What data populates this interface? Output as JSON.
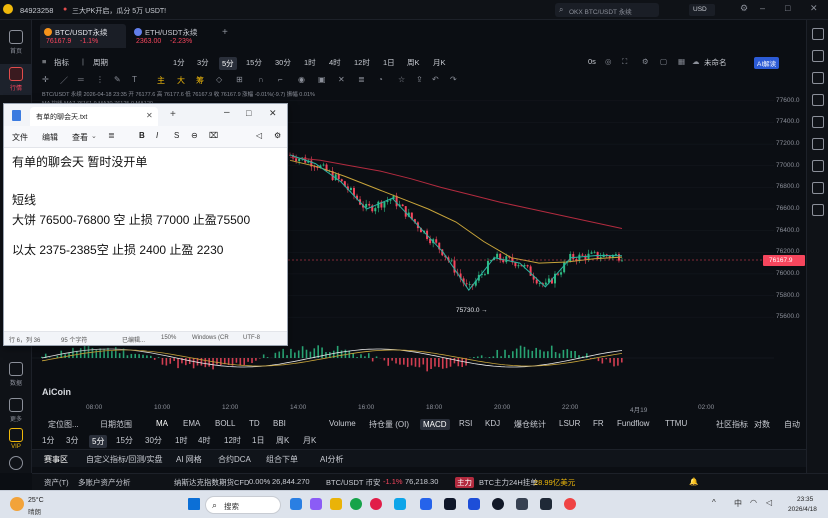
{
  "topbar": {
    "user_id": "84923258",
    "announcement": "三大PK开启，瓜分 5万 USDT!",
    "search_placeholder": "OKX BTC/USDT 永续",
    "currency": "USD"
  },
  "tabs": [
    {
      "name": "BTC/USDT永续",
      "price": "76167.9",
      "change": "-1.1%"
    },
    {
      "name": "ETH/USDT永续",
      "price": "2363.00",
      "change": "-2.23%"
    }
  ],
  "sidebar": {
    "items": [
      "首页",
      "行情",
      "数据",
      "更多",
      "VIP",
      "我的"
    ]
  },
  "timeframes": {
    "label_indicator": "指标",
    "label_period": "周期",
    "items": [
      "1分",
      "3分",
      "5分",
      "15分",
      "30分",
      "1时",
      "4时",
      "12时",
      "1日",
      "周K",
      "月K"
    ],
    "active": "5分",
    "time_label": "0s",
    "unnamed": "未命名",
    "ai_label": "AI解读"
  },
  "draw_tools": [
    "主",
    "大",
    "筹"
  ],
  "chart_info": {
    "line1": "BTC/USDT 永续  2026-04-18 23:35  开 76177.6  高 76177.6  低 76167.9  收 76167.9  涨幅 -0.01%(-9.7)  振幅 0.01%",
    "line2": "MA 均线  MA7 76161.9  MA30 76125.0  MA120 ..."
  },
  "chart_data": {
    "type": "line",
    "title": "BTC/USDT 永续",
    "xlabel": "",
    "ylabel": "",
    "y_ticks": [
      "77600.0",
      "77400.0",
      "77200.0",
      "77000.0",
      "76800.0",
      "76600.0",
      "76400.0",
      "76200.0",
      "76000.0",
      "75800.0",
      "75600.0"
    ],
    "x_ticks": [
      "08:00",
      "10:00",
      "12:00",
      "14:00",
      "16:00",
      "18:00",
      "20:00",
      "22:00",
      "4月19",
      "02:00"
    ],
    "last_price": "76167.9",
    "low_label": "75730.0",
    "ylim": [
      75500,
      77700
    ],
    "series": [
      {
        "name": "MA120",
        "color": "#b32b3f",
        "values": [
          77080,
          77050,
          77000,
          76950,
          76880,
          76800,
          76730,
          76660,
          76600,
          76540,
          76480,
          76420
        ]
      },
      {
        "name": "MA30",
        "color": "#c8a43a",
        "values": [
          77050,
          76990,
          76900,
          76800,
          76700,
          76600,
          76480,
          76300,
          76150,
          76100,
          76110,
          76140,
          76155
        ]
      },
      {
        "name": "MA7",
        "color": "#2bb5a3",
        "values": [
          77100,
          77020,
          76850,
          76600,
          76700,
          76450,
          76200,
          75850,
          76150,
          76100,
          75880,
          76150,
          76170,
          76168
        ]
      }
    ]
  },
  "indicators": {
    "left": [
      "定位图...",
      "日期范围"
    ],
    "items": [
      "MA",
      "EMA",
      "BOLL",
      "TD",
      "BBI",
      "Volume",
      "持仓量 (OI)",
      "MACD",
      "RSI",
      "KDJ",
      "爆仓统计",
      "LSUR",
      "FR",
      "Fundflow",
      "TTMU",
      "社区指标",
      "对数",
      "自动"
    ],
    "active": "MACD"
  },
  "timeframes2": [
    "1分",
    "3分",
    "5分",
    "15分",
    "30分",
    "1时",
    "4时",
    "12时",
    "1日",
    "周K",
    "月K"
  ],
  "bottom_tabs": [
    "赛事区",
    "自定义指标/回测/实盘",
    "AI 网格",
    "合约DCA",
    "组合下单",
    "AI分析"
  ],
  "ticker": {
    "assets": "资产(T)",
    "multi": "多账户资产分析",
    "t1_name": "纳斯达克指数期货CFD",
    "t1_change": "0.00%",
    "t1_price": "26,844.270",
    "t2_name": "BTC/USDT 币安",
    "t2_change": "-1.1%",
    "t2_price": "76,218.30",
    "main_label": "主力",
    "main_text": "BTC主力24H挂单",
    "main_value": "28.99亿美元"
  },
  "logo": "AiCoin",
  "notepad": {
    "title": "有单的聊会天.txt",
    "menu": [
      "文件",
      "编辑",
      "查看"
    ],
    "lines": [
      "有单的聊会天    暂时没开单",
      "",
      "短线",
      "大饼 76500-76800 空    止损 77000  止盈75500",
      "",
      "以太 2375-2385空    止损  2400  止盈  2230"
    ],
    "status": [
      "行 6，列 36",
      "95 个字符",
      "已编辑...",
      "150%",
      "Windows (CR",
      "UTF-8"
    ]
  },
  "taskbar": {
    "temp": "25°C",
    "weather": "晴朗",
    "search": "搜索",
    "time": "23:35",
    "date": "2026/4/18",
    "ime": "中"
  },
  "colors": {
    "up": "#2ebd85",
    "down": "#f6465d",
    "accent": "#f0b90b",
    "bg": "#0b0e13"
  }
}
